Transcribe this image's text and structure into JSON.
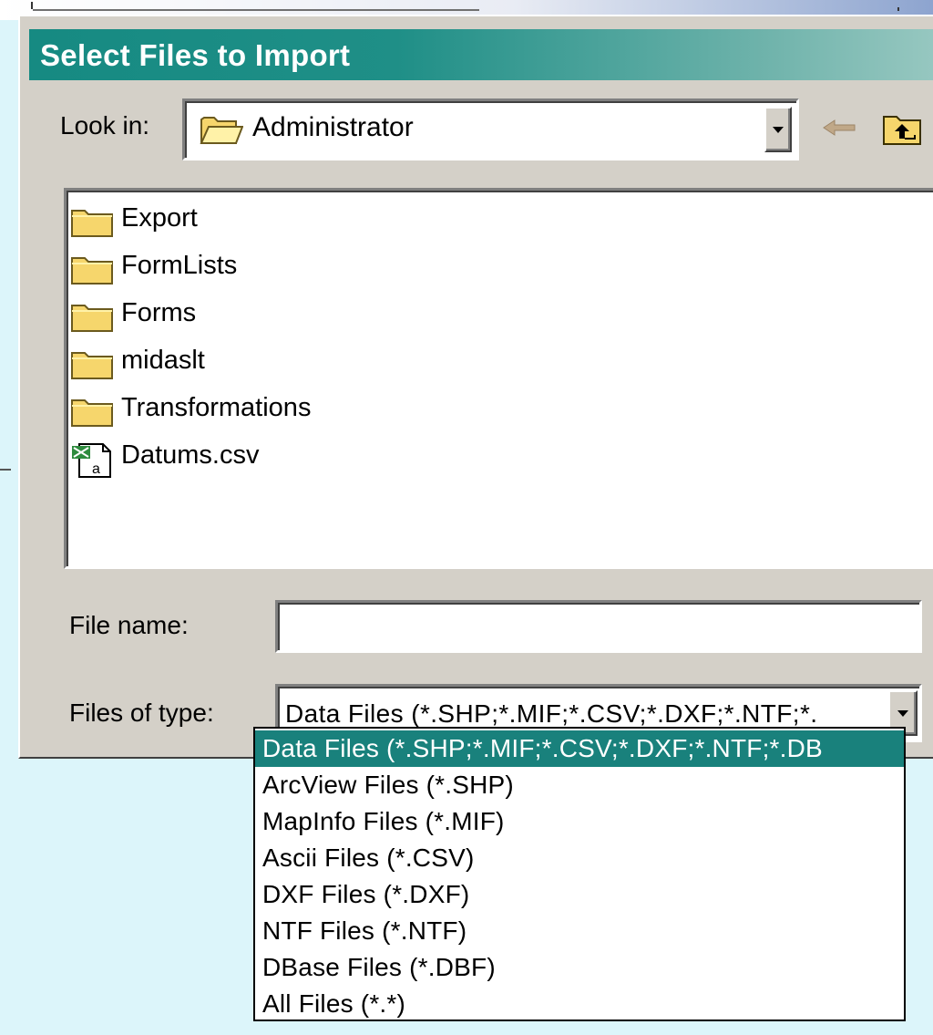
{
  "dialog": {
    "title": "Select Files to Import"
  },
  "look_in": {
    "label": "Look in:",
    "value": "Administrator",
    "icon": "open-folder-icon"
  },
  "toolbar": {
    "back_icon": "back-arrow-icon",
    "up_icon": "up-one-level-icon"
  },
  "files": [
    {
      "name": "Export",
      "icon": "folder-icon"
    },
    {
      "name": "FormLists",
      "icon": "folder-icon"
    },
    {
      "name": "Forms",
      "icon": "folder-icon"
    },
    {
      "name": "midaslt",
      "icon": "folder-icon"
    },
    {
      "name": "Transformations",
      "icon": "folder-icon"
    },
    {
      "name": "Datums.csv",
      "icon": "csv-file-icon"
    }
  ],
  "file_name": {
    "label": "File name:",
    "value": ""
  },
  "files_of_type": {
    "label": "Files of type:",
    "value": "Data Files (*.SHP;*.MIF;*.CSV;*.DXF;*.NTF;*.",
    "options": [
      "Data Files (*.SHP;*.MIF;*.CSV;*.DXF;*.NTF;*.DB",
      "ArcView Files (*.SHP)",
      "MapInfo Files (*.MIF)",
      "Ascii Files (*.CSV)",
      "DXF Files (*.DXF)",
      "NTF Files (*.NTF)",
      "DBase Files (*.DBF)",
      "All Files (*.*)"
    ],
    "selected_index": 0
  },
  "colors": {
    "title_bar": "#168a82",
    "selection": "#19817c",
    "dialog_face": "#d4d0c8"
  }
}
